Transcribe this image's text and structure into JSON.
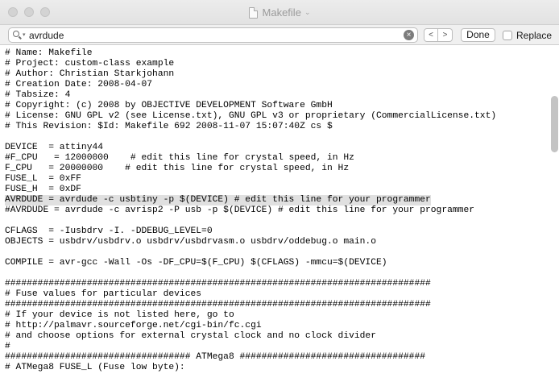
{
  "window": {
    "title": "Makefile"
  },
  "find": {
    "query": "avrdude",
    "done_label": "Done",
    "replace_label": "Replace",
    "prev_glyph": "<",
    "next_glyph": ">"
  },
  "editor": {
    "lines": [
      "# Name: Makefile",
      "# Project: custom-class example",
      "# Author: Christian Starkjohann",
      "# Creation Date: 2008-04-07",
      "# Tabsize: 4",
      "# Copyright: (c) 2008 by OBJECTIVE DEVELOPMENT Software GmbH",
      "# License: GNU GPL v2 (see License.txt), GNU GPL v3 or proprietary (CommercialLicense.txt)",
      "# This Revision: $Id: Makefile 692 2008-11-07 15:07:40Z cs $",
      "",
      "DEVICE  = attiny44",
      "#F_CPU   = 12000000    # edit this line for crystal speed, in Hz",
      "F_CPU   = 20000000    # edit this line for crystal speed, in Hz",
      "FUSE_L  = 0xFF",
      "FUSE_H  = 0xDF",
      "AVRDUDE = avrdude -c usbtiny -p $(DEVICE) # edit this line for your programmer",
      "#AVRDUDE = avrdude -c avrisp2 -P usb -p $(DEVICE) # edit this line for your programmer",
      "",
      "CFLAGS  = -Iusbdrv -I. -DDEBUG_LEVEL=0",
      "OBJECTS = usbdrv/usbdrv.o usbdrv/usbdrvasm.o usbdrv/oddebug.o main.o",
      "",
      "COMPILE = avr-gcc -Wall -Os -DF_CPU=$(F_CPU) $(CFLAGS) -mmcu=$(DEVICE)",
      "",
      "##############################################################################",
      "# Fuse values for particular devices",
      "##############################################################################",
      "# If your device is not listed here, go to",
      "# http://palmavr.sourceforge.net/cgi-bin/fc.cgi",
      "# and choose options for external crystal clock and no clock divider",
      "#",
      "################################## ATMega8 ##################################",
      "# ATMega8 FUSE_L (Fuse low byte):"
    ]
  }
}
